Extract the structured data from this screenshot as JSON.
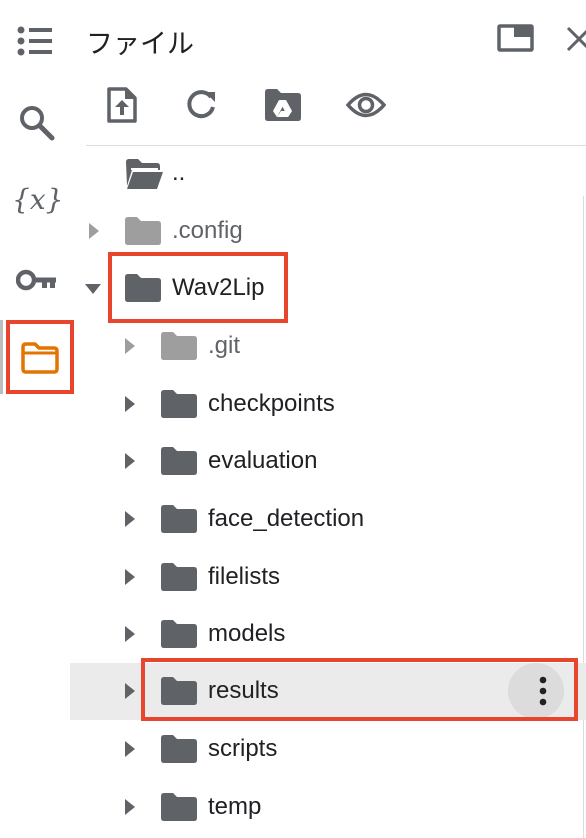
{
  "panel": {
    "title": "ファイル"
  },
  "rail": {
    "items": [
      {
        "icon": "table-of-contents-icon"
      },
      {
        "icon": "search-icon"
      },
      {
        "icon": "variables-icon",
        "label": "{x}"
      },
      {
        "icon": "key-icon"
      },
      {
        "icon": "folder-icon",
        "active": true
      }
    ]
  },
  "toolbar": {
    "items": [
      {
        "icon": "upload-file-icon"
      },
      {
        "icon": "refresh-icon"
      },
      {
        "icon": "mount-drive-icon"
      },
      {
        "icon": "show-hidden-icon"
      }
    ]
  },
  "tree": {
    "parent": {
      "label": ".."
    },
    "config": {
      "label": ".config"
    },
    "wav2lip": {
      "label": "Wav2Lip"
    },
    "children": [
      {
        "label": ".git",
        "muted": true
      },
      {
        "label": "checkpoints"
      },
      {
        "label": "evaluation"
      },
      {
        "label": "face_detection"
      },
      {
        "label": "filelists"
      },
      {
        "label": "models"
      },
      {
        "label": "results",
        "hovered": true
      },
      {
        "label": "scripts"
      },
      {
        "label": "temp"
      }
    ]
  },
  "colors": {
    "highlight": "#e8452f",
    "active_icon": "#e37400",
    "folder": "#5f6368",
    "folder_muted": "#9e9e9e"
  }
}
